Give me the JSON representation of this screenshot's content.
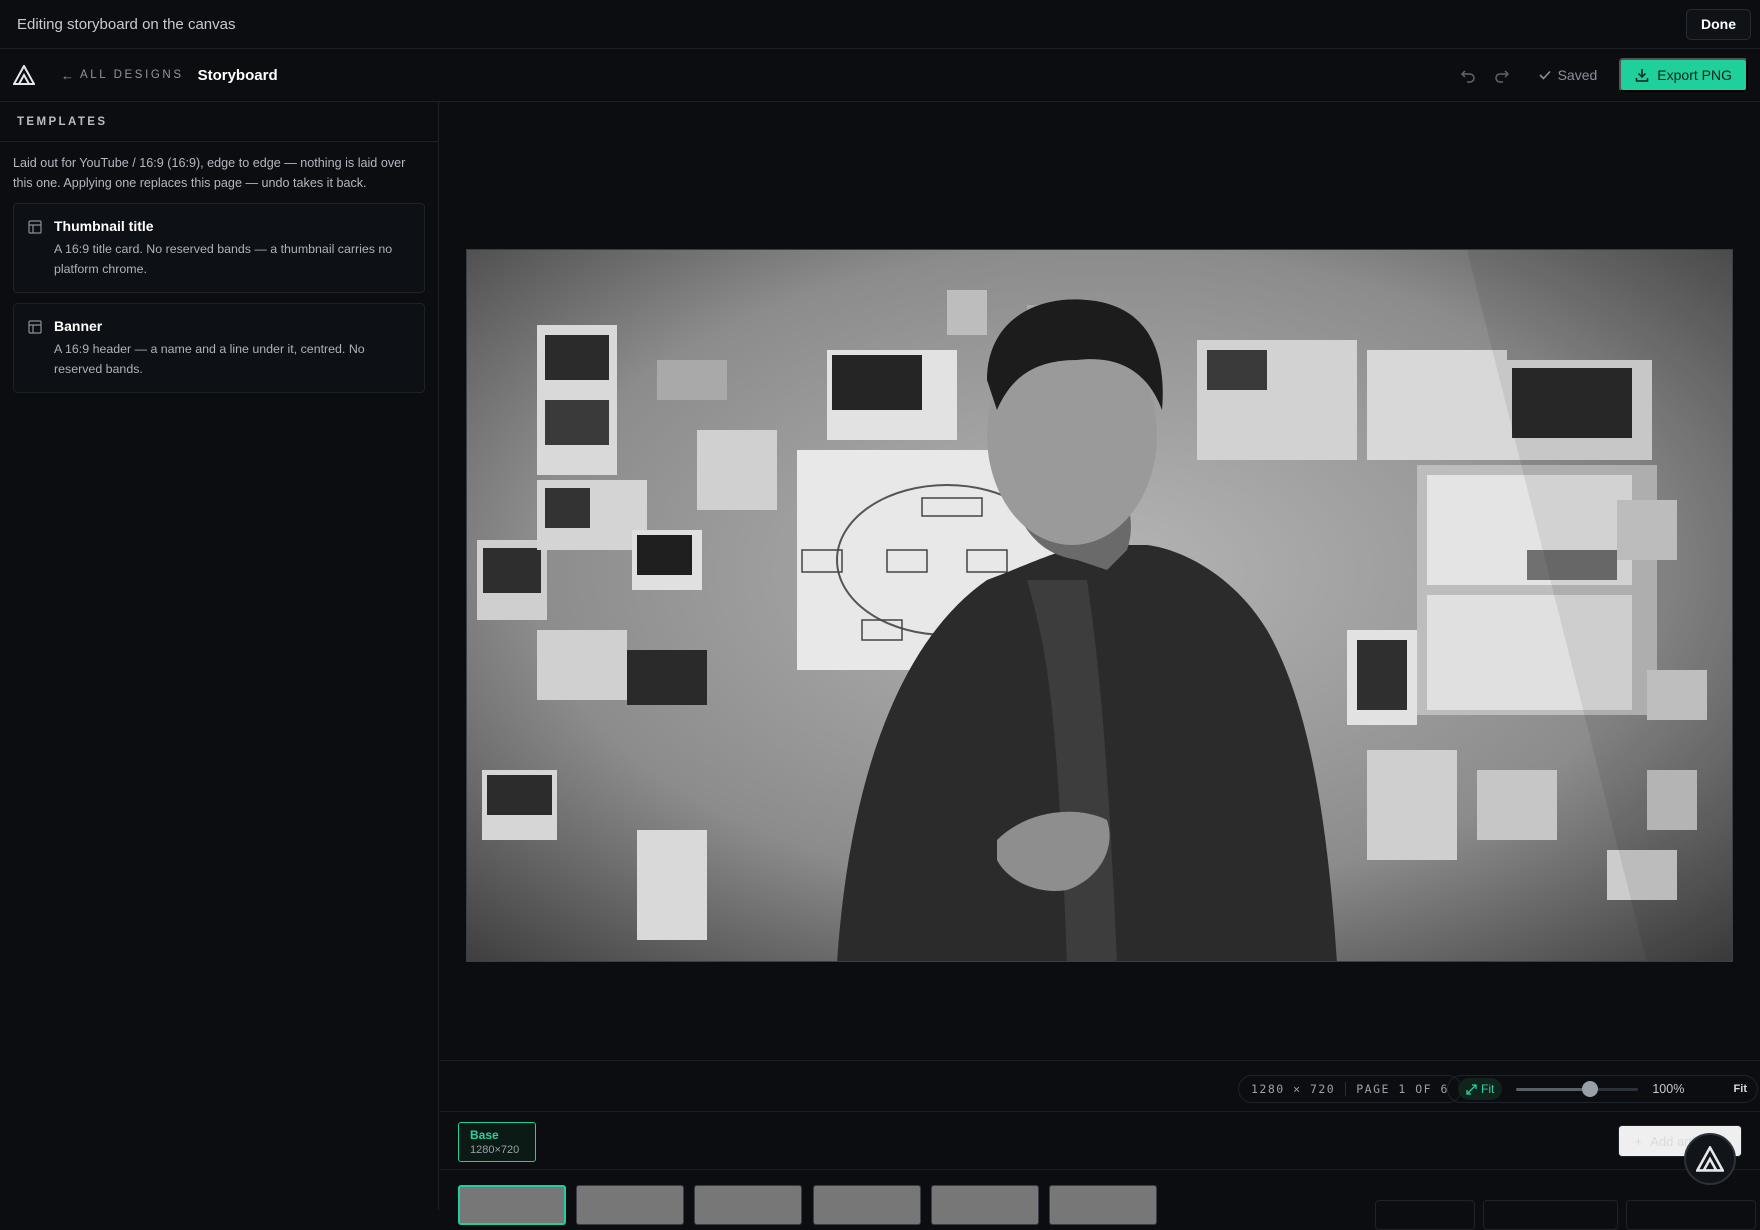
{
  "topbar": {
    "title": "Editing storyboard on the canvas",
    "done_label": "Done"
  },
  "header": {
    "back_label": "ALL DESIGNS",
    "doc_title": "Storyboard",
    "saved_label": "Saved",
    "export_label": "Export PNG"
  },
  "sidebar": {
    "section_title": "TEMPLATES",
    "note": "Laid out for YouTube / 16:9 (16:9), edge to edge — nothing is laid over this one. Applying one replaces this page — undo takes it back.",
    "templates": [
      {
        "name": "Thumbnail title",
        "desc": "A 16:9 title card. No reserved bands — a thumbnail carries no platform chrome."
      },
      {
        "name": "Banner",
        "desc": "A 16:9 header — a name and a line under it, centred. No reserved bands."
      }
    ]
  },
  "canvas_footer": {
    "dimensions": "1280 × 720",
    "page": "PAGE 1 OF 6",
    "fit_label": "Fit",
    "zoom_value": 0.6,
    "zoom_label": "100%",
    "fit_end_label": "Fit"
  },
  "artboards": {
    "base_name": "Base",
    "base_size": "1280×720",
    "add_label": "Add artboard"
  },
  "colors": {
    "accent": "#1fcf9c",
    "background": "#0b0d11",
    "border": "#1c2027"
  },
  "icons": [
    "logo-icon",
    "back-arrow-icon",
    "undo-icon",
    "redo-icon",
    "check-icon",
    "download-icon",
    "template-icon",
    "expand-icon",
    "plus-icon"
  ]
}
